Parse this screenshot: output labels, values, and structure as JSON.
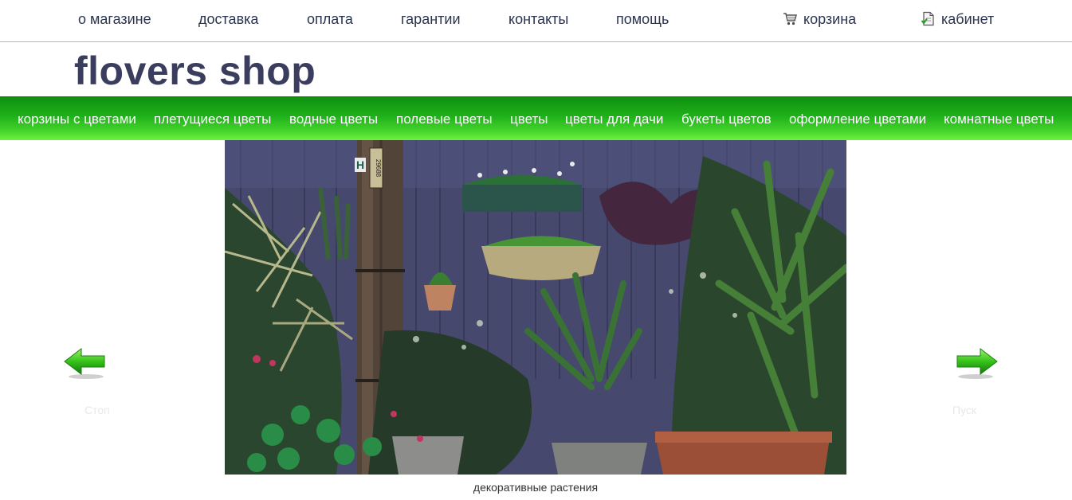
{
  "topnav": {
    "items": [
      "о магазине",
      "доставка",
      "оплата",
      "гарантии",
      "контакты",
      "помощь"
    ],
    "cart_label": "корзина",
    "cart_icon": "cart-icon",
    "cabinet_label": "кабинет",
    "cabinet_icon": "document-check-icon"
  },
  "logo": "flovers shop",
  "categories": [
    "корзины с цветами",
    "плетущиеся цветы",
    "водные цветы",
    "полевые цветы",
    "цветы",
    "цветы для дачи",
    "букеты цветов",
    "оформление цветами",
    "комнатные цветы"
  ],
  "slider": {
    "caption": "декоративные растения",
    "stop_label": "Стоп",
    "play_label": "Пуск",
    "prev_icon": "arrow-left-icon",
    "next_icon": "arrow-right-icon",
    "photo_sign": "29688",
    "photo_letter": "H"
  },
  "colors": {
    "text_dark": "#2b3450",
    "logo": "#3a3d5e",
    "green_bar_top": "#0e8f0e",
    "green_bar_bottom": "#6ff23e"
  }
}
